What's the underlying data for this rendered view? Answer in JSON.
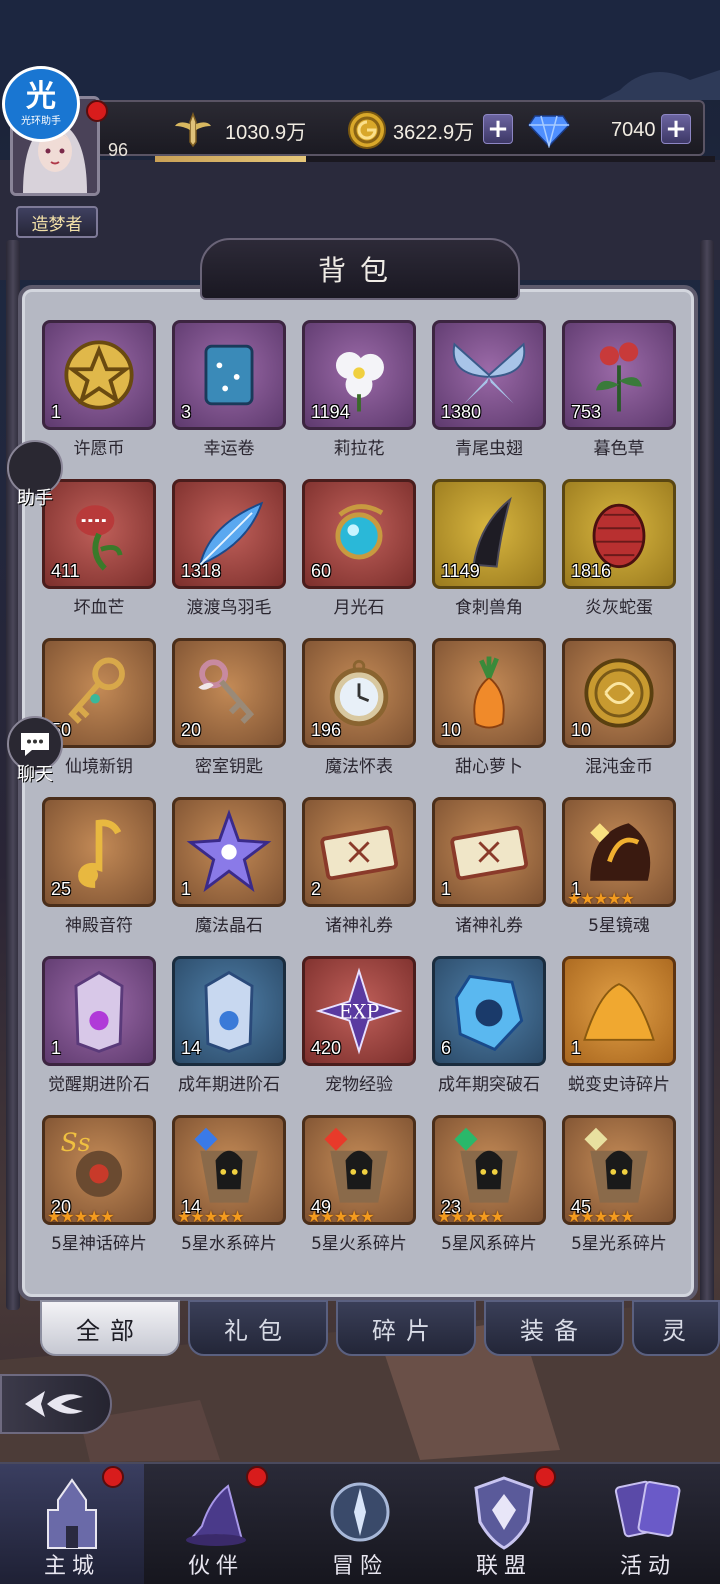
{
  "header": {
    "helper_badge": {
      "glyph": "光",
      "text": "光环助手"
    },
    "player_level": "96",
    "player_title": "造梦者",
    "level_progress": 0.27,
    "resources": [
      {
        "icon": "winged-sword-icon",
        "value": "1030.9万"
      },
      {
        "icon": "gold-coin-icon",
        "value": "3622.9万"
      },
      {
        "icon": "diamond-icon",
        "value": "7040"
      }
    ]
  },
  "panel": {
    "title": "背包"
  },
  "side": {
    "helper_label": "助手",
    "chat_label": "聊天"
  },
  "items": [
    {
      "name": "许愿币",
      "count": "1",
      "rarity": "purple",
      "icon": "wish-coin-icon"
    },
    {
      "name": "幸运卷",
      "count": "3",
      "rarity": "purple",
      "icon": "lucky-scroll-icon"
    },
    {
      "name": "莉拉花",
      "count": "1194",
      "rarity": "purple",
      "icon": "lila-flower-icon"
    },
    {
      "name": "青尾虫翅",
      "count": "1380",
      "rarity": "purple",
      "icon": "insect-wing-icon"
    },
    {
      "name": "暮色草",
      "count": "753",
      "rarity": "purple",
      "icon": "twilight-herb-icon"
    },
    {
      "name": "坏血芒",
      "count": "411",
      "rarity": "red",
      "icon": "carnivorous-plant-icon"
    },
    {
      "name": "渡渡鸟羽毛",
      "count": "1318",
      "rarity": "red",
      "icon": "feather-icon"
    },
    {
      "name": "月光石",
      "count": "60",
      "rarity": "red",
      "icon": "moonstone-icon"
    },
    {
      "name": "食刺兽角",
      "count": "1149",
      "rarity": "gold",
      "icon": "beast-horn-icon"
    },
    {
      "name": "炎灰蛇蛋",
      "count": "1816",
      "rarity": "gold",
      "icon": "snake-egg-icon"
    },
    {
      "name": "仙境新钥",
      "count": "50",
      "rarity": "bronze",
      "icon": "wonderland-key-icon"
    },
    {
      "name": "密室钥匙",
      "count": "20",
      "rarity": "bronze",
      "icon": "chamber-key-icon"
    },
    {
      "name": "魔法怀表",
      "count": "196",
      "rarity": "bronze",
      "icon": "pocket-watch-icon"
    },
    {
      "name": "甜心萝卜",
      "count": "10",
      "rarity": "bronze",
      "icon": "carrot-icon"
    },
    {
      "name": "混沌金币",
      "count": "10",
      "rarity": "bronze",
      "icon": "chaos-coin-icon"
    },
    {
      "name": "神殿音符",
      "count": "25",
      "rarity": "bronze",
      "icon": "music-note-icon"
    },
    {
      "name": "魔法晶石",
      "count": "1",
      "rarity": "bronze",
      "icon": "magic-crystal-icon"
    },
    {
      "name": "诸神礼券",
      "count": "2",
      "rarity": "bronze",
      "icon": "ticket-icon"
    },
    {
      "name": "诸神礼券",
      "count": "1",
      "rarity": "bronze",
      "icon": "ticket-icon"
    },
    {
      "name": "5星镜魂",
      "count": "1",
      "rarity": "bronze",
      "icon": "mirror-soul-icon",
      "stars": 5
    },
    {
      "name": "觉醒期进阶石",
      "count": "1",
      "rarity": "purple",
      "icon": "awakening-stone-icon"
    },
    {
      "name": "成年期进阶石",
      "count": "14",
      "rarity": "blue",
      "icon": "adult-stone-icon"
    },
    {
      "name": "宠物经验",
      "count": "420",
      "rarity": "red",
      "icon": "pet-exp-icon"
    },
    {
      "name": "成年期突破石",
      "count": "6",
      "rarity": "blue",
      "icon": "breakthrough-stone-icon"
    },
    {
      "name": "蜕变史诗碎片",
      "count": "1",
      "rarity": "orange",
      "icon": "sand-pile-icon"
    },
    {
      "name": "5星神话碎片",
      "count": "20",
      "rarity": "bronze",
      "icon": "myth-shard-icon",
      "stars": 5
    },
    {
      "name": "5星水系碎片",
      "count": "14",
      "rarity": "bronze",
      "icon": "water-shard-icon",
      "stars": 5
    },
    {
      "name": "5星火系碎片",
      "count": "49",
      "rarity": "bronze",
      "icon": "fire-shard-icon",
      "stars": 5
    },
    {
      "name": "5星风系碎片",
      "count": "23",
      "rarity": "bronze",
      "icon": "wind-shard-icon",
      "stars": 5
    },
    {
      "name": "5星光系碎片",
      "count": "45",
      "rarity": "bronze",
      "icon": "light-shard-icon",
      "stars": 5
    }
  ],
  "tabs": [
    {
      "label": "全部",
      "active": true
    },
    {
      "label": "礼包",
      "active": false
    },
    {
      "label": "碎片",
      "active": false
    },
    {
      "label": "装备",
      "active": false
    },
    {
      "label": "灵",
      "active": false
    }
  ],
  "nav": [
    {
      "label": "主城",
      "icon": "castle-icon",
      "active": true,
      "badge": true
    },
    {
      "label": "伙伴",
      "icon": "wizard-hat-icon",
      "active": false,
      "badge": true
    },
    {
      "label": "冒险",
      "icon": "compass-icon",
      "active": false,
      "badge": false
    },
    {
      "label": "联盟",
      "icon": "shield-icon",
      "active": false,
      "badge": true
    },
    {
      "label": "活动",
      "icon": "cards-icon",
      "active": false,
      "badge": false
    }
  ]
}
